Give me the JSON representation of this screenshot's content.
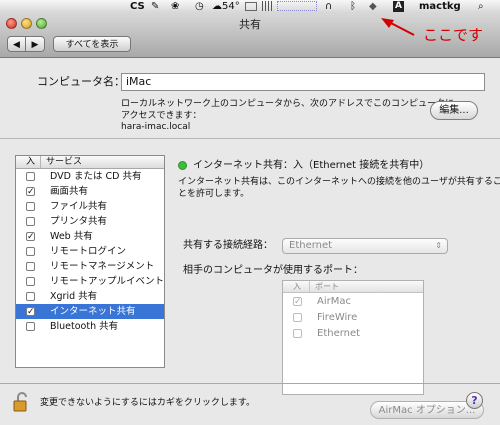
{
  "menubar": {
    "apple_icon": "apple-logo",
    "icon_cs": "CS",
    "weather": "54°",
    "wifi_icon": "wifi",
    "font_icon": "A",
    "user": "mactkg"
  },
  "annotation": {
    "text": "ここです",
    "color": "#d40000"
  },
  "window": {
    "title": "共有",
    "show_all_label": "すべてを表示",
    "back_label": "◀",
    "forward_label": "▶"
  },
  "computer": {
    "name_label": "コンピュータ名：",
    "name_value": "iMac",
    "description": "ローカルネットワーク上のコンピュータから、次のアドレスでこのコンピュータに",
    "address_prefix": "アクセスできます：",
    "address": "hara-imac.local",
    "edit_label": "編集..."
  },
  "services": {
    "header_on": "入",
    "header_service": "サービス",
    "items": [
      {
        "label": "DVD または CD 共有",
        "checked": false,
        "selected": false
      },
      {
        "label": "画面共有",
        "checked": true,
        "selected": false
      },
      {
        "label": "ファイル共有",
        "checked": false,
        "selected": false
      },
      {
        "label": "プリンタ共有",
        "checked": false,
        "selected": false
      },
      {
        "label": "Web 共有",
        "checked": true,
        "selected": false
      },
      {
        "label": "リモートログイン",
        "checked": false,
        "selected": false
      },
      {
        "label": "リモートマネージメント",
        "checked": false,
        "selected": false
      },
      {
        "label": "リモートアップルイベント",
        "checked": false,
        "selected": false
      },
      {
        "label": "Xgrid 共有",
        "checked": false,
        "selected": false
      },
      {
        "label": "インターネット共有",
        "checked": true,
        "selected": true
      },
      {
        "label": "Bluetooth 共有",
        "checked": false,
        "selected": false
      }
    ]
  },
  "detail": {
    "status_color": "#36c236",
    "status_text": "インターネット共有：入（Ethernet 接続を共有中）",
    "description_line1": "インターネット共有は、このインターネットへの接続を他のユーザが共有するこ",
    "description_line2": "とを許可します。",
    "share_from_label": "共有する接続経路：",
    "share_from_value": "Ethernet",
    "ports_label": "相手のコンピュータが使用するポート：",
    "ports_header_on": "入",
    "ports_header_port": "ポート",
    "ports": [
      {
        "label": "AirMac",
        "checked": true
      },
      {
        "label": "FireWire",
        "checked": false
      },
      {
        "label": "Ethernet",
        "checked": false
      }
    ],
    "airmac_options_label": "AirMac オプション..."
  },
  "footer": {
    "lock_text": "変更できないようにするにはカギをクリックします。",
    "help_label": "?"
  }
}
